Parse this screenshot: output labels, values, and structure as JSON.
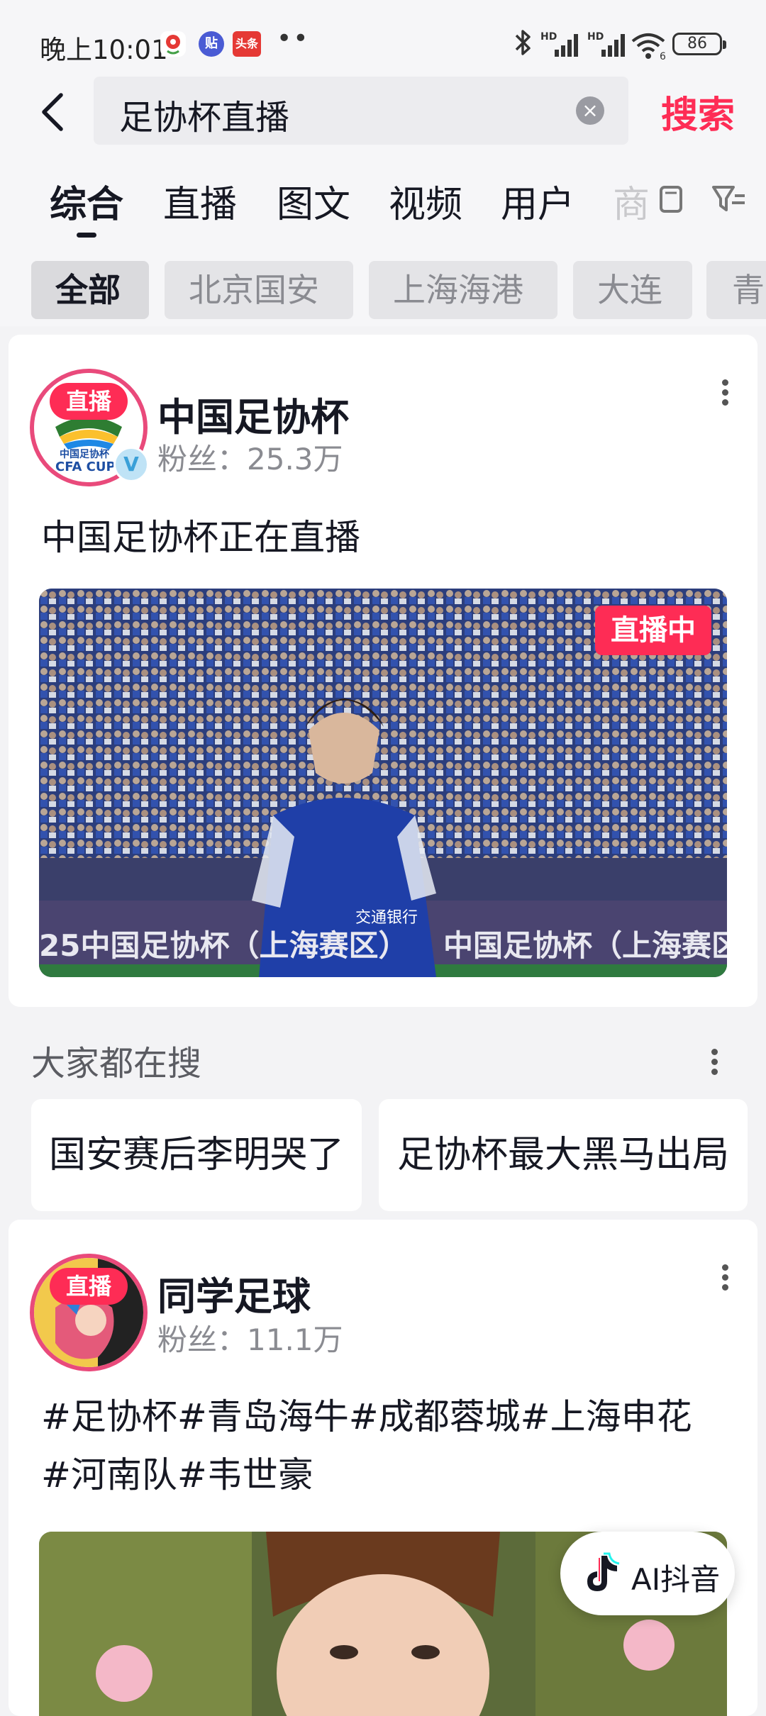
{
  "status_bar": {
    "time": "晚上10:01",
    "app_icons": [
      "map-pin-app",
      "tie-app",
      "toutiao-app"
    ],
    "app_icon_texts": [
      "贴",
      "头条"
    ],
    "network": [
      "HD",
      "HD"
    ],
    "battery": "86"
  },
  "search": {
    "query": "足协杯直播",
    "button_label": "搜索"
  },
  "tabs": {
    "items": [
      "综合",
      "直播",
      "图文",
      "视频",
      "用户"
    ],
    "faded": "商",
    "active": "综合"
  },
  "filters": {
    "chips": [
      "全部",
      "北京国安",
      "上海海港",
      "大连",
      "青"
    ]
  },
  "card1": {
    "avatar_live_tag": "直播",
    "avatar_caption": "中国足协杯",
    "avatar_caption_en": "CFA CUP",
    "account_name": "中国足协杯",
    "fans": "粉丝：25.3万",
    "post_title": "中国足协杯正在直播",
    "live_badge": "直播中",
    "banner_text_1": "25中国足协杯（上海赛区）",
    "banner_text_2": "中国足协杯（上海赛区）",
    "jersey_text": "交通银行"
  },
  "trending": {
    "title": "大家都在搜",
    "items": [
      "国安赛后李明哭了",
      "足协杯最大黑马出局"
    ]
  },
  "card2": {
    "avatar_live_tag": "直播",
    "account_name": "同学足球",
    "fans": "粉丝：11.1万",
    "post_lines": [
      "#足协杯#青岛海牛#成都蓉城#上海申花",
      "#河南队#韦世豪"
    ]
  },
  "ai_button": {
    "label": "AI抖音"
  },
  "colors": {
    "accent": "#fe2c55",
    "avatar_ring": "#e94a7b",
    "muted_text": "#8a8b91"
  }
}
